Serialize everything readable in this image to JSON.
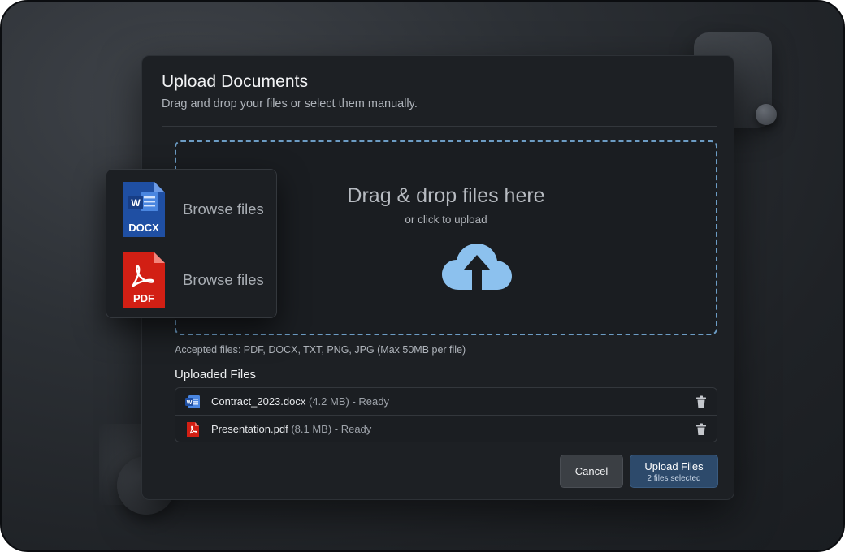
{
  "dialog": {
    "title": "Upload Documents",
    "subtitle": "Drag and drop your files or select them manually."
  },
  "dropzone": {
    "title": "Drag & drop files here",
    "subtitle": "or click to upload",
    "icon": "cloud-upload-icon",
    "border_color": "#6c9cc4",
    "icon_color": "#8cc1ee"
  },
  "accepted_text": "Accepted files: PDF, DOCX, TXT, PNG, JPG (Max 50MB per file)",
  "uploaded": {
    "heading": "Uploaded Files",
    "files": [
      {
        "name": "Contract_2023.docx",
        "meta": "(4.2 MB) - Ready",
        "icon": "word-file-icon"
      },
      {
        "name": "Presentation.pdf",
        "meta": "(8.1 MB) - Ready",
        "icon": "pdf-file-icon"
      }
    ]
  },
  "buttons": {
    "cancel": "Cancel",
    "upload": "Upload Files",
    "upload_sub": "2 files selected"
  },
  "browse": {
    "items": [
      {
        "badge": "DOCX",
        "letter": "W",
        "label": "Browse files",
        "icon": "docx-file-icon",
        "color": "#1f4fa3"
      },
      {
        "badge": "PDF",
        "label": "Browse files",
        "icon": "pdf-file-icon",
        "color": "#d21f14"
      }
    ]
  }
}
